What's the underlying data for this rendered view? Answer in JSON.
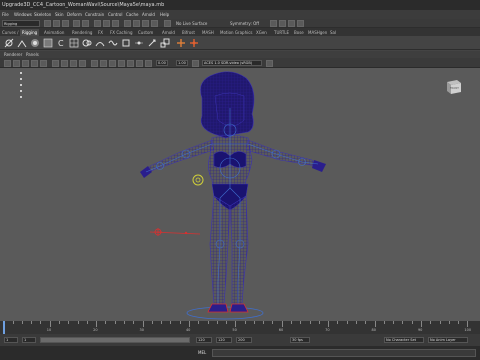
{
  "window": {
    "title": "Upgrade3D_CC4_Cartoon_WomanWavi\\Source\\Maya5e\\maya.mb"
  },
  "menubar": {
    "items": [
      "File",
      "Windows",
      "Skeleton",
      "Skin",
      "Deform",
      "Constrain",
      "Control",
      "Cache",
      "Arnold",
      "Help"
    ]
  },
  "statusline": {
    "mode_label": "Rigging",
    "no_live_surface": "No Live Surface",
    "symmetry": "Symmetry: Off"
  },
  "shelf_tabs": {
    "items": [
      "Curves / Surfaces",
      "Poly Modeling",
      "Sculpting",
      "Rigging",
      "Animation",
      "Rendering",
      "FX",
      "FX Caching",
      "Custom",
      "Arnold",
      "Bifrost",
      "MASH",
      "Motion Graphics",
      "XGen",
      "TURTLE",
      "Bose",
      "MASHgen",
      "Sal"
    ],
    "active_index": 3
  },
  "panel_menu": {
    "items": [
      "Renderer",
      "Panels"
    ]
  },
  "panel_toolbar": {
    "near_value": "0.00",
    "far_value": "1.00",
    "color_space": "ACES 1.0 SDR-video (sRGB)"
  },
  "viewcube": {
    "label": "FRONT"
  },
  "timeline": {
    "ticks": [
      2,
      4,
      6,
      8,
      10,
      12,
      14,
      16,
      18,
      20,
      22,
      24,
      26,
      28,
      30,
      32,
      34,
      36,
      38,
      40,
      42,
      44,
      46,
      48,
      50,
      52,
      54,
      56,
      58,
      60,
      62,
      64,
      66,
      68,
      70,
      72,
      74,
      76,
      78,
      80,
      82,
      84,
      86,
      88,
      90,
      92,
      94,
      96,
      98,
      100
    ],
    "current_frame": "1"
  },
  "range_slider": {
    "start": "1",
    "start_inner": "1",
    "end_inner": "120",
    "end": "120",
    "anim_end": "200",
    "fps": "30 fps",
    "character_set": "No Character Set",
    "anim_layer": "No Anim Layer"
  },
  "command_line": {
    "label": "MEL"
  },
  "colors": {
    "viewport_bg": "#5a5a5a",
    "wireframe": "#2a1e8c",
    "joint": "#3f6fcf",
    "selected_handle": "#d93030",
    "ik_handle": "#cfcf3a"
  }
}
